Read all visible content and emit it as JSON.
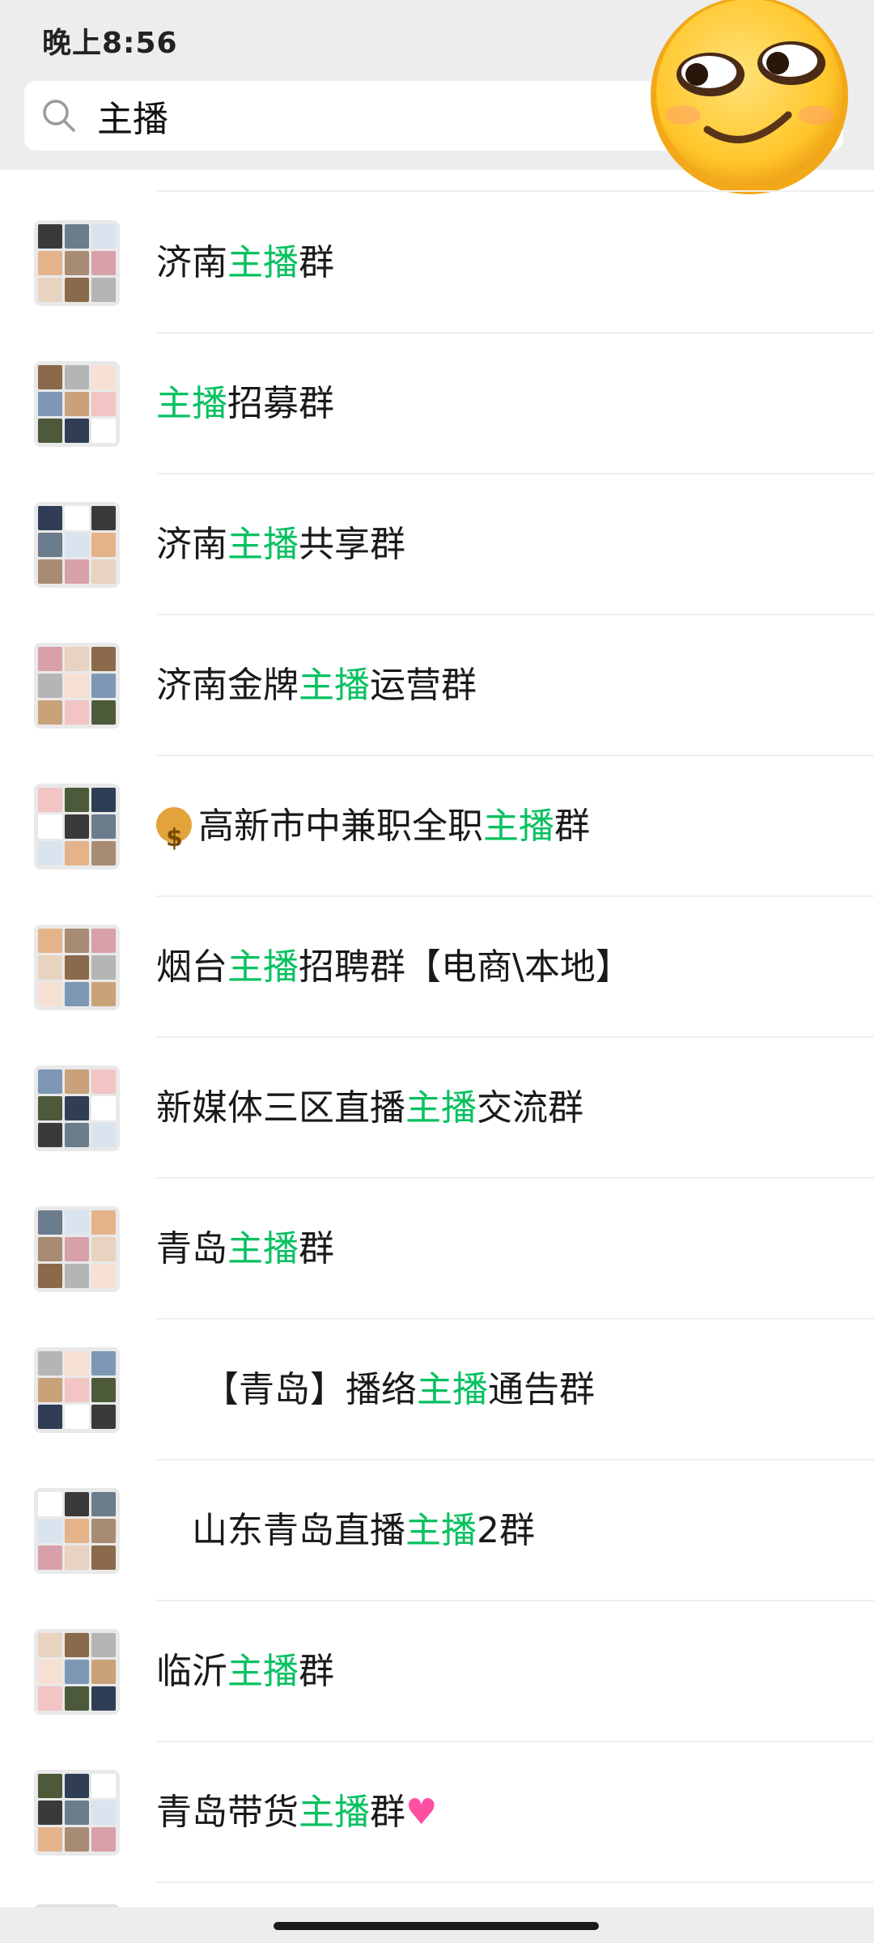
{
  "status_bar": {
    "time": "晚上8:56"
  },
  "search": {
    "query": "主播",
    "icon": "search-icon"
  },
  "sticker": {
    "icon": "smirk-emoji-icon"
  },
  "colors": {
    "highlight": "#07c160",
    "background_bar": "#ededed"
  },
  "results": [
    {
      "segments": [
        {
          "t": "济南",
          "h": false
        },
        {
          "t": "主播",
          "h": true
        },
        {
          "t": "群",
          "h": false
        }
      ]
    },
    {
      "segments": [
        {
          "t": "主播",
          "h": true
        },
        {
          "t": "招募群",
          "h": false
        }
      ]
    },
    {
      "segments": [
        {
          "t": "济南",
          "h": false
        },
        {
          "t": "主播",
          "h": true
        },
        {
          "t": "共享群",
          "h": false
        }
      ]
    },
    {
      "segments": [
        {
          "t": "济南金牌",
          "h": false
        },
        {
          "t": "主播",
          "h": true
        },
        {
          "t": "运营群",
          "h": false
        }
      ]
    },
    {
      "prefix_icon": "money-bag-icon",
      "segments": [
        {
          "t": "高新市中兼职全职",
          "h": false
        },
        {
          "t": "主播",
          "h": true
        },
        {
          "t": "群",
          "h": false
        }
      ]
    },
    {
      "segments": [
        {
          "t": "烟台",
          "h": false
        },
        {
          "t": "主播",
          "h": true
        },
        {
          "t": "招聘群【电商\\本地】",
          "h": false
        }
      ]
    },
    {
      "segments": [
        {
          "t": "新媒体三区直播",
          "h": false
        },
        {
          "t": "主播",
          "h": true
        },
        {
          "t": "交流群",
          "h": false
        }
      ]
    },
    {
      "segments": [
        {
          "t": "青岛",
          "h": false
        },
        {
          "t": "主播",
          "h": true
        },
        {
          "t": "群",
          "h": false
        }
      ]
    },
    {
      "segments": [
        {
          "t": "　 【青岛】播络",
          "h": false
        },
        {
          "t": "主播",
          "h": true
        },
        {
          "t": "通告群",
          "h": false
        }
      ]
    },
    {
      "segments": [
        {
          "t": "　山东青岛直播",
          "h": false
        },
        {
          "t": "主播",
          "h": true
        },
        {
          "t": "2群",
          "h": false
        }
      ]
    },
    {
      "segments": [
        {
          "t": "临沂",
          "h": false
        },
        {
          "t": "主播",
          "h": true
        },
        {
          "t": "群",
          "h": false
        }
      ]
    },
    {
      "suffix_icon": "two-hearts-icon",
      "segments": [
        {
          "t": "青岛带货",
          "h": false
        },
        {
          "t": "主播",
          "h": true
        },
        {
          "t": "群",
          "h": false
        }
      ]
    }
  ]
}
